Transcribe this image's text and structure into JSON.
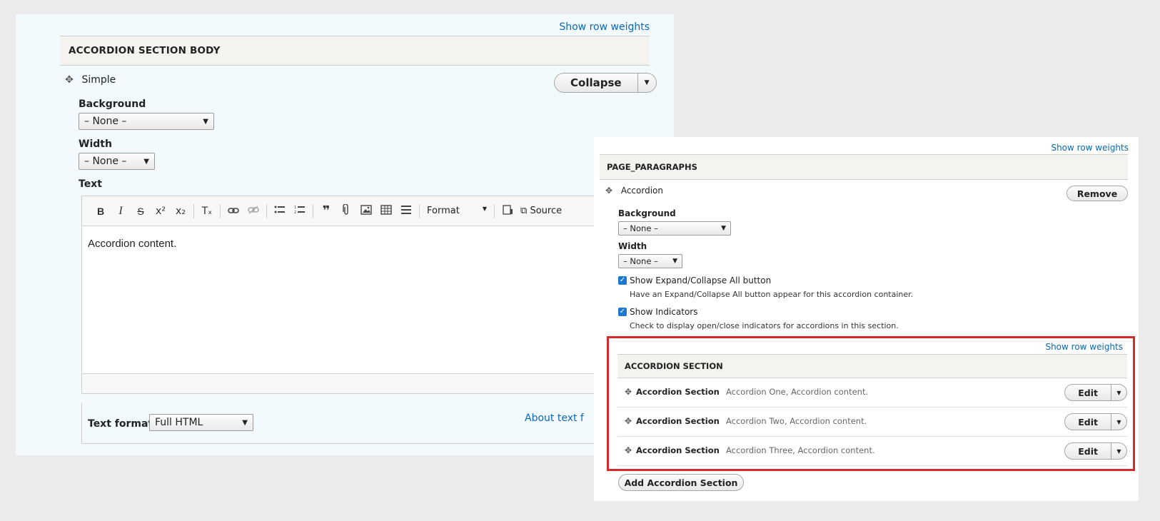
{
  "left_panel": {
    "show_row_weights": "Show row weights",
    "section_title": "ACCORDION SECTION BODY",
    "row_label": "Simple",
    "collapse_button": "Collapse",
    "background_label": "Background",
    "background_value": "– None –",
    "width_label": "Width",
    "width_value": "– None –",
    "text_label": "Text",
    "toolbar": {
      "bold": "B",
      "italic": "I",
      "strike": "S",
      "superscript": "x²",
      "subscript": "x₂",
      "remove_format": "Tₓ",
      "format_label": "Format",
      "source_label": "Source"
    },
    "editor_content": "Accordion content.",
    "text_format_label": "Text format",
    "text_format_value": "Full HTML",
    "about_text_formats": "About text f"
  },
  "right_panel": {
    "show_row_weights": "Show row weights",
    "section_title": "PAGE_PARAGRAPHS",
    "row_label": "Accordion",
    "remove_button": "Remove",
    "background_label": "Background",
    "background_value": "– None –",
    "width_label": "Width",
    "width_value": "– None –",
    "expand_collapse_label": "Show Expand/Collapse All button",
    "expand_collapse_desc": "Have an Expand/Collapse All button appear for this accordion container.",
    "indicators_label": "Show Indicators",
    "indicators_desc": "Check to display open/close indicators for accordions in this section.",
    "accordion_section": {
      "show_row_weights": "Show row weights",
      "title": "ACCORDION SECTION",
      "rows": [
        {
          "name": "Accordion Section",
          "summary": "Accordion One, Accordion content.",
          "edit": "Edit"
        },
        {
          "name": "Accordion Section",
          "summary": "Accordion Two, Accordion content.",
          "edit": "Edit"
        },
        {
          "name": "Accordion Section",
          "summary": "Accordion Three, Accordion content.",
          "edit": "Edit"
        }
      ]
    },
    "add_button": "Add Accordion Section"
  },
  "colors": {
    "link": "#0a68b4",
    "highlight_border": "#d32a2a",
    "left_panel_bg": "#f3fafe",
    "checkbox": "#1e78d2"
  }
}
